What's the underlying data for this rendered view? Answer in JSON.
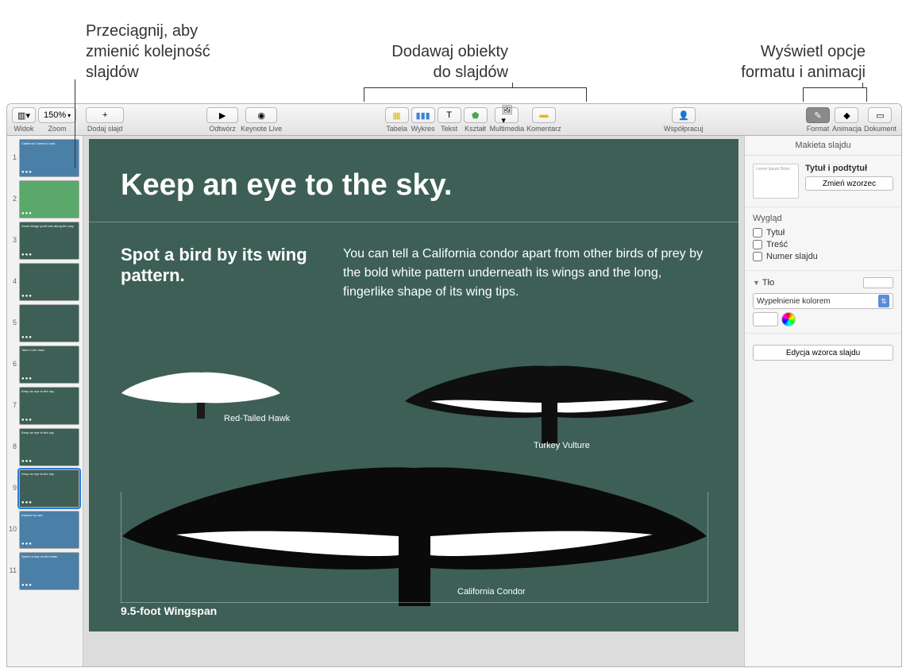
{
  "callouts": {
    "reorder": "Przeciągnij, aby\nzmienić kolejność\nslajdów",
    "add_objects": "Dodawaj obiekty\ndo slajdów",
    "format_anim": "Wyświetl opcje\nformatu i animacji"
  },
  "toolbar": {
    "view": {
      "label": "Widok"
    },
    "zoom": {
      "value": "150%",
      "label": "Zoom"
    },
    "add_slide": {
      "label": "Dodaj slajd"
    },
    "play": {
      "label": "Odtwórz"
    },
    "keynote_live": {
      "label": "Keynote Live"
    },
    "table": {
      "label": "Tabela"
    },
    "chart": {
      "label": "Wykres"
    },
    "text": {
      "label": "Tekst"
    },
    "shape": {
      "label": "Kształt"
    },
    "media": {
      "label": "Multimedia"
    },
    "comment": {
      "label": "Komentarz"
    },
    "collaborate": {
      "label": "Współpracuj"
    },
    "format": {
      "label": "Format"
    },
    "animate": {
      "label": "Animacja"
    },
    "document": {
      "label": "Dokument"
    }
  },
  "navigator": {
    "slides": [
      {
        "num": "1",
        "title": "California Central Coast"
      },
      {
        "num": "2",
        "title": ""
      },
      {
        "num": "3",
        "title": "Some things you'll see along the way"
      },
      {
        "num": "4",
        "title": ""
      },
      {
        "num": "5",
        "title": ""
      },
      {
        "num": "6",
        "title": "Take in the vista"
      },
      {
        "num": "7",
        "title": "Keep an eye to the sky"
      },
      {
        "num": "8",
        "title": "Keep an eye to the sky"
      },
      {
        "num": "9",
        "title": "Keep an eye to the sky",
        "selected": true
      },
      {
        "num": "10",
        "title": "Explore by sea"
      },
      {
        "num": "11",
        "title": "Spend a day on the water"
      }
    ]
  },
  "slide": {
    "title": "Keep an eye to the sky.",
    "subtitle": "Spot a bird by its wing pattern.",
    "body": "You can tell a California condor apart from other birds of prey by the bold white pattern underneath its wings and the long, fingerlike shape of its wing tips.",
    "bird1": "Red-Tailed Hawk",
    "bird2": "Turkey Vulture",
    "bird3": "California Condor",
    "wingspan": "9.5-foot Wingspan"
  },
  "inspector": {
    "header": "Makieta slajdu",
    "layout_thumb_text": "Lorem Ipsum Dolor",
    "layout_name": "Tytuł i podtytuł",
    "change_master": "Zmień wzorzec",
    "appearance": "Wygląd",
    "title_cb": "Tytuł",
    "body_cb": "Treść",
    "slide_num_cb": "Numer slajdu",
    "background": "Tło",
    "fill_type": "Wypełnienie kolorem",
    "edit_master": "Edycja wzorca slajdu"
  }
}
